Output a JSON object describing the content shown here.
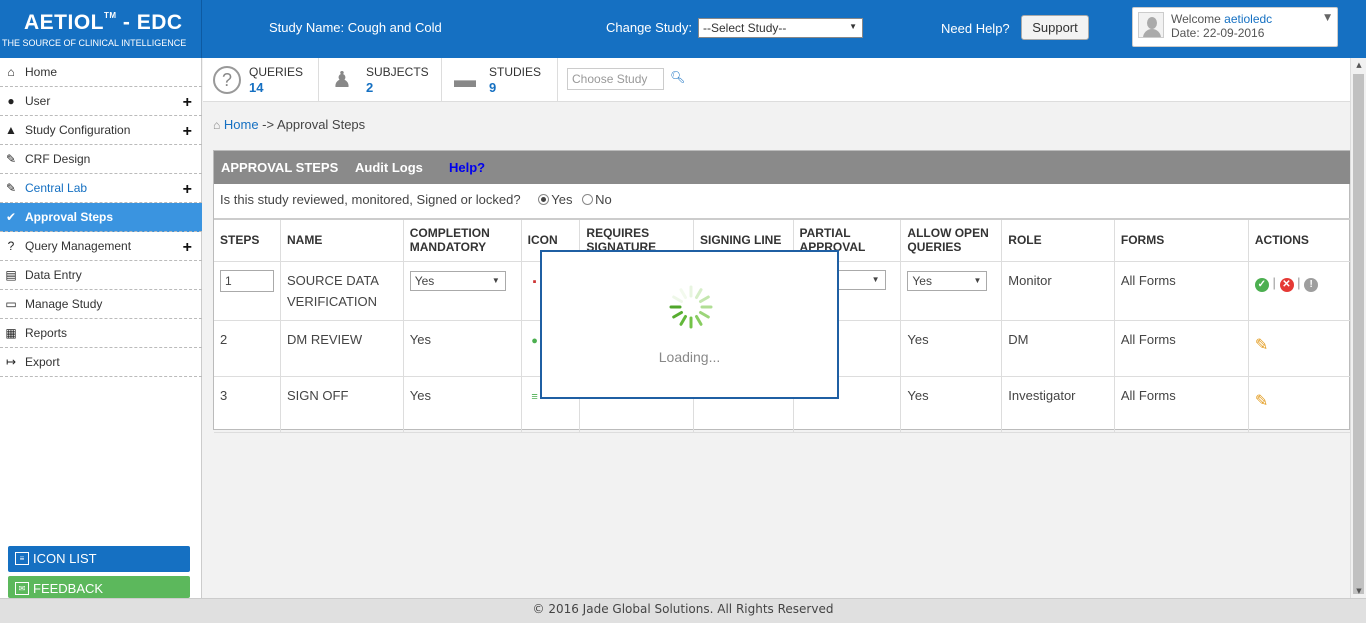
{
  "header": {
    "logo_title": "AETIOL",
    "logo_tm": "TM",
    "logo_suffix": " - EDC",
    "logo_tagline": "THE SOURCE OF CLINICAL INTELLIGENCE",
    "study_name": "Study Name: Cough and Cold",
    "change_study_label": "Change Study:",
    "study_select_value": "--Select Study--",
    "need_help": "Need Help?",
    "support_label": "Support",
    "welcome_label": "Welcome",
    "username": "aetioledc",
    "date_text": "Date: 22-09-2016"
  },
  "sidebar": {
    "items": [
      {
        "label": "Home",
        "icon": "home-icon",
        "has_plus": false
      },
      {
        "label": "User",
        "icon": "user-icon",
        "has_plus": true
      },
      {
        "label": "Study Configuration",
        "icon": "study-config-icon",
        "has_plus": true
      },
      {
        "label": "CRF Design",
        "icon": "crf-design-icon",
        "has_plus": false
      },
      {
        "label": "Central Lab",
        "icon": "central-lab-icon",
        "has_plus": true
      },
      {
        "label": "Approval Steps",
        "icon": "approval-check-icon",
        "has_plus": false
      },
      {
        "label": "Query Management",
        "icon": "query-icon",
        "has_plus": true
      },
      {
        "label": "Data Entry",
        "icon": "data-entry-icon",
        "has_plus": false
      },
      {
        "label": "Manage Study",
        "icon": "manage-study-icon",
        "has_plus": false
      },
      {
        "label": "Reports",
        "icon": "reports-icon",
        "has_plus": false
      },
      {
        "label": "Export",
        "icon": "export-icon",
        "has_plus": false
      }
    ],
    "active": "Approval Steps",
    "icon_list_label": "ICON LIST",
    "feedback_label": "FEEDBACK"
  },
  "stats": {
    "queries": {
      "label": "QUERIES",
      "count": "14"
    },
    "subjects": {
      "label": "SUBJECTS",
      "count": "2"
    },
    "studies": {
      "label": "STUDIES",
      "count": "9"
    },
    "choose_study_placeholder": "Choose Study"
  },
  "breadcrumb": {
    "home": "Home",
    "separator": " -> ",
    "current": "Approval Steps"
  },
  "panel": {
    "tabs": [
      "APPROVAL STEPS",
      "Audit Logs",
      "Help?"
    ],
    "review_question": "Is this study reviewed, monitored, Signed or locked?",
    "yes_label": "Yes",
    "no_label": "No",
    "selected": "Yes"
  },
  "table": {
    "headers": [
      "STEPS",
      "NAME",
      "COMPLETION MANDATORY",
      "ICON",
      "REQUIRES SIGNATURE",
      "SIGNING LINE",
      "PARTIAL APPROVAL",
      "ALLOW OPEN QUERIES",
      "ROLE",
      "FORMS",
      "ACTIONS"
    ],
    "rows": [
      {
        "step": "1",
        "name": "SOURCE DATA VERIFICATION",
        "completion": "Yes",
        "open_queries": "Yes",
        "role": "Monitor",
        "forms": "All Forms"
      },
      {
        "step": "2",
        "name": "DM REVIEW",
        "completion": "Yes",
        "open_queries": "Yes",
        "role": "DM",
        "forms": "All Forms"
      },
      {
        "step": "3",
        "name": "SIGN OFF",
        "completion": "Yes",
        "open_queries": "Yes",
        "role": "Investigator",
        "forms": "All Forms"
      }
    ]
  },
  "loading": {
    "text": "Loading..."
  },
  "footer": {
    "text": "© 2016 Jade Global Solutions. All Rights Reserved"
  },
  "colors": {
    "brand_blue": "#1570c2",
    "active_item": "#3a94e0",
    "panel_header": "#8a8a8a",
    "feedback_green": "#5cb85c"
  }
}
